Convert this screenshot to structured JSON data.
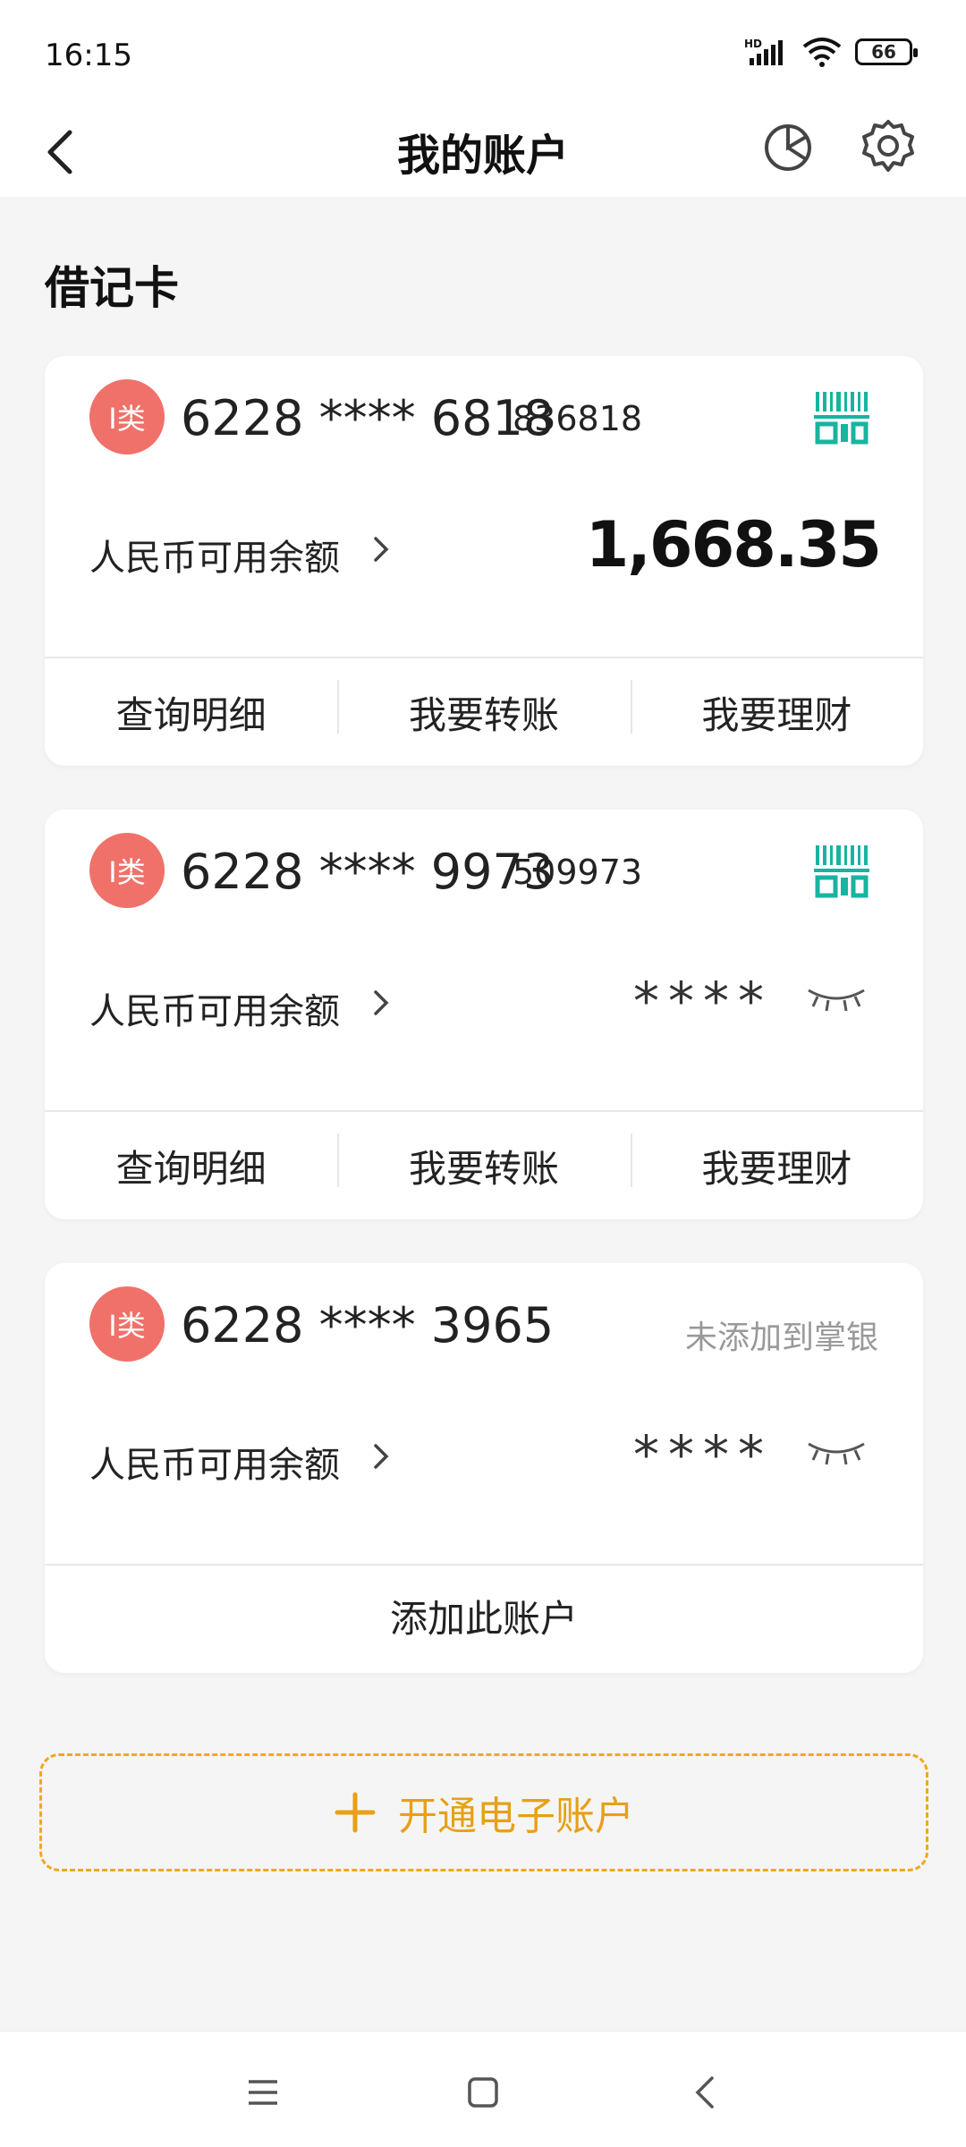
{
  "status": {
    "time": "16:15",
    "battery": "66"
  },
  "header": {
    "title": "我的账户"
  },
  "section": {
    "title": "借记卡"
  },
  "cards": [
    {
      "badge": "I类",
      "number": "6228 **** 6818",
      "suffix": "836818",
      "balance_label": "人民币可用余额",
      "balance": "1,668.35",
      "actions": [
        "查询明细",
        "我要转账",
        "我要理财"
      ]
    },
    {
      "badge": "I类",
      "number": "6228 **** 9973",
      "suffix": "509973",
      "balance_label": "人民币可用余额",
      "balance_masked": "****",
      "actions": [
        "查询明细",
        "我要转账",
        "我要理财"
      ]
    },
    {
      "badge": "I类",
      "number": "6228 **** 3965",
      "status": "未添加到掌银",
      "balance_label": "人民币可用余额",
      "balance_masked": "****",
      "add_label": "添加此账户"
    }
  ],
  "open_account": {
    "label": "开通电子账户"
  },
  "colors": {
    "badge": "#f07169",
    "qr": "#19b3a0",
    "accent": "#e8a015"
  },
  "icons": [
    "back-icon",
    "pie-chart-icon",
    "gear-icon",
    "qr-code-icon",
    "eye-closed-icon",
    "plus-icon",
    "menu-icon",
    "home-icon",
    "nav-back-icon"
  ]
}
